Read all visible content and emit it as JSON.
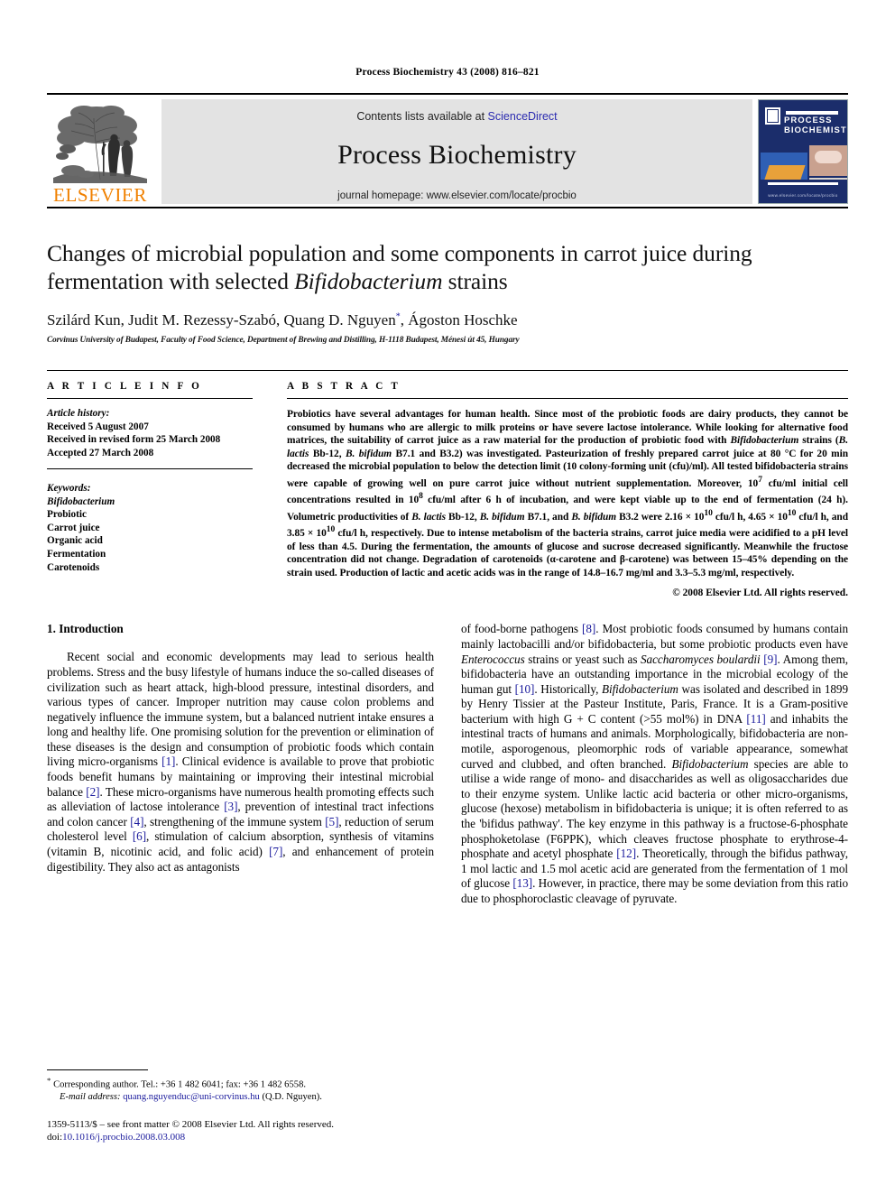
{
  "running_head": "Process Biochemistry 43 (2008) 816–821",
  "masthead": {
    "publisher_name": "ELSEVIER",
    "contents_prefix": "Contents lists available at ",
    "sciencedirect": "ScienceDirect",
    "journal_name": "Process Biochemistry",
    "homepage": "journal homepage: www.elsevier.com/locate/procbio",
    "cover_title": "PROCESS BIOCHEMISTRY",
    "cover_footer": "www.elsevier.com/locate/procbio",
    "link_color": "#2b2bb0",
    "brand_color": "#F08000"
  },
  "article": {
    "title_line1": "Changes of microbial population and some components in carrot juice during",
    "title_line2_pre": "fermentation with selected ",
    "title_italic": "Bifidobacterium",
    "title_line2_post": " strains",
    "authors": "Szilárd Kun, Judit M. Rezessy-Szabó, Quang D. Nguyen",
    "corresponding_marker": "*",
    "authors_tail": ", Ágoston Hoschke",
    "affiliation": "Corvinus University of Budapest, Faculty of Food Science, Department of Brewing and Distilling, H-1118 Budapest, Ménesi út 45, Hungary"
  },
  "info": {
    "heading": "A R T I C L E   I N F O",
    "history_label": "Article history:",
    "history": [
      "Received 5 August 2007",
      "Received in revised form 25 March 2008",
      "Accepted 27 March 2008"
    ],
    "keywords_label": "Keywords:",
    "keywords": [
      "Bifidobacterium",
      "Probiotic",
      "Carrot juice",
      "Organic acid",
      "Fermentation",
      "Carotenoids"
    ],
    "keyword_italic_index": 0
  },
  "abstract": {
    "heading": "A B S T R A C T",
    "p1": "Probiotics have several advantages for human health. Since most of the probiotic foods are dairy products, they cannot be consumed by humans who are allergic to milk proteins or have severe lactose intolerance. While looking for alternative food matrices, the suitability of carrot juice as a raw material for the production of probiotic food with ",
    "i1": "Bifidobacterium",
    "p2": " strains (",
    "i2": "B. lactis",
    "p3": " Bb-12, ",
    "i3": "B. bifidum",
    "p4": " B7.1 and B3.2) was investigated. Pasteurization of freshly prepared carrot juice at 80 °C for 20 min decreased the microbial population to below the detection limit (10 colony-forming unit (cfu)/ml). All tested bifidobacteria strains were capable of growing well on pure carrot juice without nutrient supplementation. Moreover, 10",
    "sup1": "7",
    "p5": " cfu/ml initial cell concentrations resulted in 10",
    "sup2": "8",
    "p6": " cfu/ml after 6 h of incubation, and were kept viable up to the end of fermentation (24 h). Volumetric productivities of ",
    "i4": "B. lactis",
    "p7": " Bb-12, ",
    "i5": "B. bifidum",
    "p8": " B7.1, and ",
    "i6": "B. bifidum",
    "p9": " B3.2 were 2.16 × 10",
    "sup3": "10",
    "p10": " cfu/l h, 4.65 × 10",
    "sup4": "10",
    "p11": " cfu/l h, and 3.85 × 10",
    "sup5": "10",
    "p12": " cfu/l h, respectively. Due to intense metabolism of the bacteria strains, carrot juice media were acidified to a pH level of less than 4.5. During the fermentation, the amounts of glucose and sucrose decreased significantly. Meanwhile the fructose concentration did not change. Degradation of carotenoids (α-carotene and β-carotene) was between 15–45% depending on the strain used. Production of lactic and acetic acids was in the range of 14.8–16.7 mg/ml and 3.3–5.3 mg/ml, respectively.",
    "copyright": "© 2008 Elsevier Ltd. All rights reserved."
  },
  "introduction": {
    "heading": "1. Introduction",
    "left_p1_a": "Recent social and economic developments may lead to serious health problems. Stress and the busy lifestyle of humans induce the so-called diseases of civilization such as heart attack, high-blood pressure, intestinal disorders, and various types of cancer. Improper nutrition may cause colon problems and negatively influence the immune system, but a balanced nutrient intake ensures a long and healthy life. One promising solution for the prevention or elimination of these diseases is the design and consumption of probiotic foods which contain living micro-organisms ",
    "ref1": "[1]",
    "left_p1_b": ". Clinical evidence is available to prove that probiotic foods benefit humans by maintaining or improving their intestinal microbial balance ",
    "ref2": "[2]",
    "left_p1_c": ". These micro-organisms have numerous health promoting effects such as alleviation of lactose intolerance ",
    "ref3": "[3]",
    "left_p1_d": ", prevention of intestinal tract infections and colon cancer ",
    "ref4": "[4]",
    "left_p1_e": ", strengthening of the immune system ",
    "ref5": "[5]",
    "left_p1_f": ", reduction of serum cholesterol level ",
    "ref6": "[6]",
    "left_p1_g": ", stimulation of calcium absorption, synthesis of vitamins (vitamin B, nicotinic acid, and folic acid) ",
    "ref7": "[7]",
    "left_p1_h": ", and enhancement of protein digestibility. They also act as antagonists",
    "right_a": "of food-borne pathogens ",
    "ref8": "[8]",
    "right_b": ". Most probiotic foods consumed by humans contain mainly lactobacilli and/or bifidobacteria, but some probiotic products even have ",
    "ri1": "Enterococcus",
    "right_c": " strains or yeast such as ",
    "ri2": "Saccharomyces boulardii",
    "right_d": " ",
    "ref9": "[9]",
    "right_e": ". Among them, bifidobacteria have an outstanding importance in the microbial ecology of the human gut ",
    "ref10": "[10]",
    "right_f": ". Historically, ",
    "ri3": "Bifidobacterium",
    "right_g": " was isolated and described in 1899 by Henry Tissier at the Pasteur Institute, Paris, France. It is a Gram-positive bacterium with high G + C content (>55 mol%) in DNA ",
    "ref11": "[11]",
    "right_h": " and inhabits the intestinal tracts of humans and animals. Morphologically, bifidobacteria are non-motile, asporogenous, pleomorphic rods of variable appearance, somewhat curved and clubbed, and often branched. ",
    "ri4": "Bifidobacterium",
    "right_i": " species are able to utilise a wide range of mono- and disaccharides as well as oligosaccharides due to their enzyme system. Unlike lactic acid bacteria or other micro-organisms, glucose (hexose) metabolism in bifidobacteria is unique; it is often referred to as the 'bifidus pathway'. The key enzyme in this pathway is a fructose-6-phosphate phosphoketolase (F6PPK), which cleaves fructose phosphate to erythrose-4-phosphate and acetyl phosphate ",
    "ref12": "[12]",
    "right_j": ". Theoretically, through the bifidus pathway, 1 mol lactic and 1.5 mol acetic acid are generated from the fermentation of 1 mol of glucose ",
    "ref13": "[13]",
    "right_k": ". However, in practice, there may be some deviation from this ratio due to phosphoroclastic cleavage of pyruvate."
  },
  "footer": {
    "corresponding_marker": "*",
    "corresponding": " Corresponding author. Tel.: +36 1 482 6041; fax: +36 1 482 6558.",
    "email_label": "E-mail address:",
    "email": "quang.nguyenduc@uni-corvinus.hu",
    "email_suffix": " (Q.D. Nguyen).",
    "issn_line": "1359-5113/$ – see front matter © 2008 Elsevier Ltd. All rights reserved.",
    "doi_label": "doi:",
    "doi": "10.1016/j.procbio.2008.03.008"
  }
}
